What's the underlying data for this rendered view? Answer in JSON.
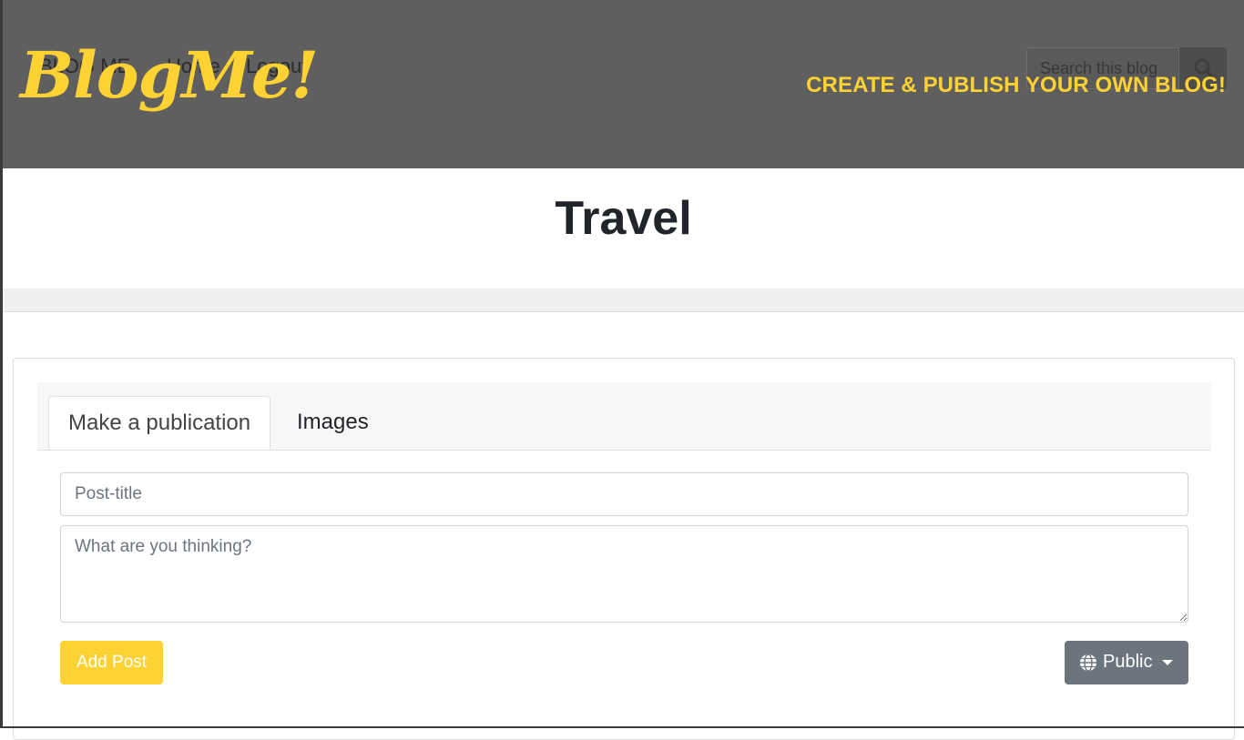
{
  "header": {
    "logo": "BlogMe!",
    "nav_brand": "BLOG ME",
    "nav_home": "Home",
    "nav_logout": "Logout",
    "search_placeholder": "Search this blog",
    "tagline": "CREATE & PUBLISH YOUR OWN BLOG!"
  },
  "blog": {
    "title": "Travel"
  },
  "composer": {
    "tabs": [
      {
        "label": "Make a publication",
        "active": true
      },
      {
        "label": "Images",
        "active": false
      }
    ],
    "title_placeholder": "Post-title",
    "body_placeholder": "What are you thinking?",
    "add_label": "Add Post",
    "visibility_label": "Public"
  },
  "icons": {
    "search": "search-icon",
    "globe": "globe-icon",
    "caret": "caret-down-icon"
  },
  "colors": {
    "header_bg": "#5f5f5f",
    "brand_yellow": "#fdd232",
    "secondary_button": "#6c757d"
  }
}
